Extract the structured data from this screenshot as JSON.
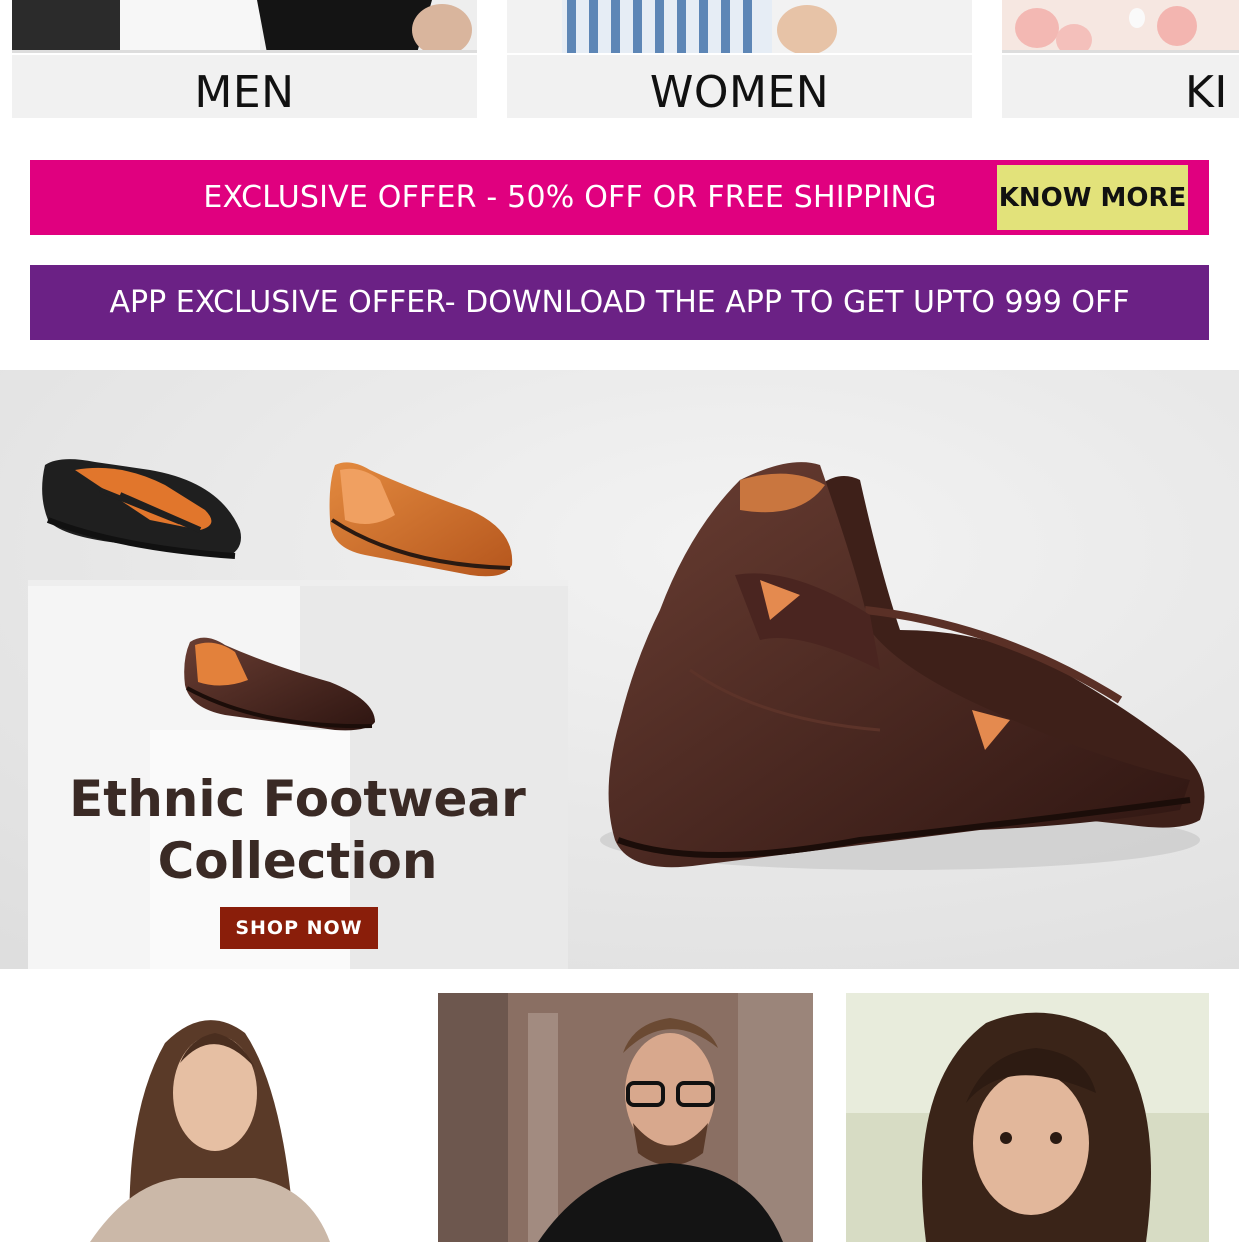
{
  "categories": [
    {
      "label": "MEN"
    },
    {
      "label": "WOMEN"
    },
    {
      "label": "KI"
    }
  ],
  "offers": {
    "primary_text": "EXCLUSIVE OFFER - 50% OFF OR FREE SHIPPING",
    "primary_button": "KNOW MORE",
    "app_text": "APP EXCLUSIVE OFFER- DOWNLOAD THE APP TO GET UPTO 999 OFF"
  },
  "hero": {
    "title_line1": "Ethnic Footwear",
    "title_line2": "Collection",
    "cta": "SHOP NOW"
  },
  "colors": {
    "offer_pink": "#e0007f",
    "offer_purple": "#6b2185",
    "know_more_bg": "#e2e27a",
    "shop_now_bg": "#8a1e0a"
  }
}
